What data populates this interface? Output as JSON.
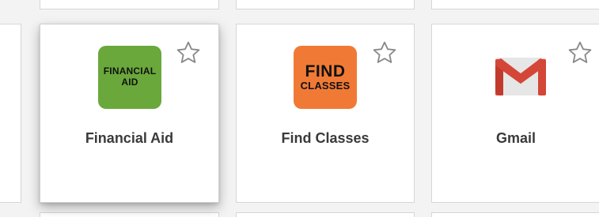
{
  "tiles": [
    {
      "label": "Financial Aid",
      "icon_name": "financial-aid-icon",
      "icon_text": [
        "FINANCIAL",
        "AID"
      ],
      "icon_color": "#6aa83b",
      "favorite": false
    },
    {
      "label": "Find Classes",
      "icon_name": "find-classes-icon",
      "icon_text": [
        "FIND",
        "CLASSES"
      ],
      "icon_color": "#f07a35",
      "favorite": false
    },
    {
      "label": "Gmail",
      "icon_name": "gmail-icon",
      "icon_colors": {
        "red": "#d44638",
        "dark_red": "#b23121",
        "envelope": "#e6e6e6"
      },
      "favorite": false
    }
  ],
  "star_icon_name": "star-outline-icon",
  "colors": {
    "page_background": "#f3f3f3",
    "tile_background": "#ffffff",
    "tile_border": "#d6d6d6",
    "label_text": "#3a3a3a",
    "star_stroke": "#8a8a8a"
  }
}
